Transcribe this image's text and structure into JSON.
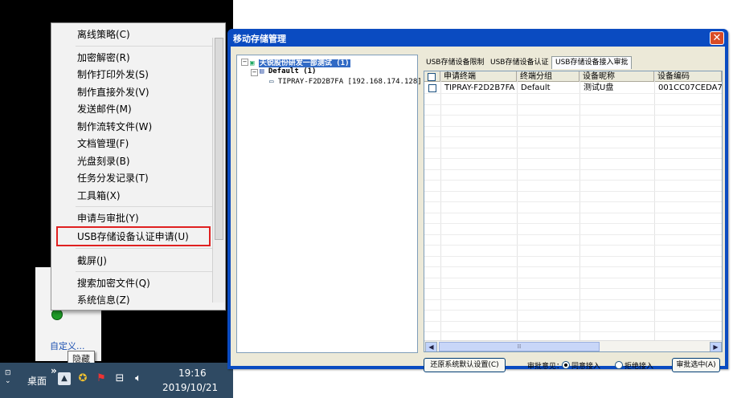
{
  "context_menu": {
    "items": [
      {
        "label": "离线策略(C)"
      },
      {
        "label": "加密解密(R)"
      },
      {
        "label": "制作打印外发(S)"
      },
      {
        "label": "制作直接外发(V)"
      },
      {
        "label": "发送邮件(M)"
      },
      {
        "label": "制作流转文件(W)"
      },
      {
        "label": "文档管理(F)"
      },
      {
        "label": "光盘刻录(B)"
      },
      {
        "label": "任务分发记录(T)"
      },
      {
        "label": "工具箱(X)"
      },
      {
        "label": "申请与审批(Y)"
      },
      {
        "label": "USB存储设备认证申请(U)"
      },
      {
        "label": "截屏(J)"
      },
      {
        "label": "搜索加密文件(Q)"
      },
      {
        "label": "系统信息(Z)"
      }
    ]
  },
  "taskbar": {
    "desktop_label": "桌面",
    "time": "19:16",
    "date": "2019/10/21",
    "tooltip": "隐藏",
    "custom_link": "自定义..."
  },
  "window": {
    "title": "移动存储管理",
    "tree": {
      "root": "天锐股份研发一部测试 (1)",
      "group": "Default (1)",
      "device": "TIPRAY-F2D2B7FA [192.168.174.128]"
    },
    "tabs": [
      {
        "label": "USB存储设备限制"
      },
      {
        "label": "USB存储设备认证"
      },
      {
        "label": "USB存储设备接入审批"
      }
    ],
    "table": {
      "columns": [
        "申请终端",
        "终端分组",
        "设备昵称",
        "设备编码"
      ],
      "rows": [
        {
          "terminal": "TIPRAY-F2D2B7FA",
          "group": "Default",
          "nickname": "测试U盘",
          "code": "001CC07CEDA7."
        }
      ]
    },
    "bottom": {
      "restore_button": "还原系统默认设置(C)",
      "opinion_label": "审批意见：",
      "approve_option": "同意接入",
      "reject_option": "拒绝接入",
      "approve_selected_button": "审批选中(A)",
      "selected_option": "同意接入"
    }
  }
}
